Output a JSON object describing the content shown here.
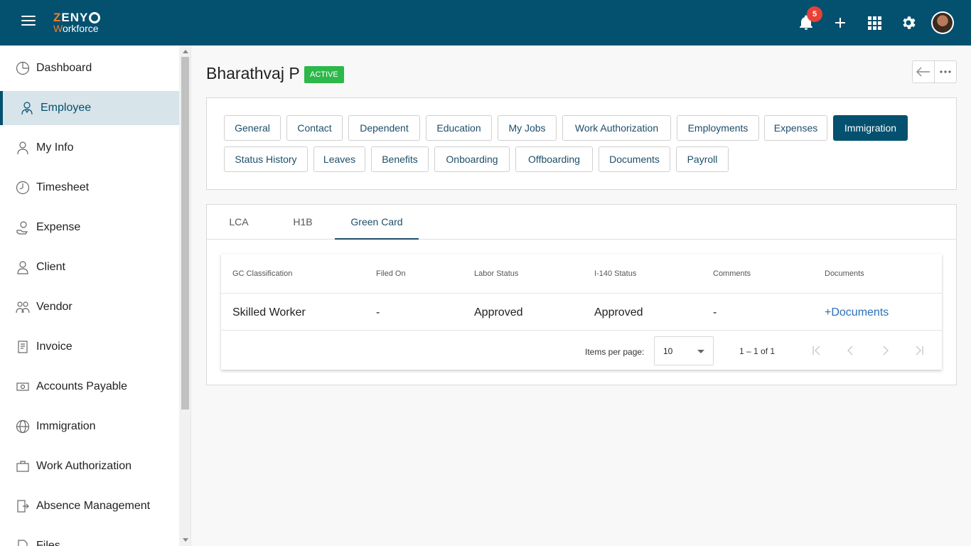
{
  "header": {
    "logo_top_letter": "Z",
    "logo_top_rest": "ENY",
    "logo_sub_first": "W",
    "logo_sub_rest": "orkforce",
    "notification_count": "5"
  },
  "sidebar": {
    "items": [
      {
        "label": "Dashboard",
        "icon": "dashboard-icon"
      },
      {
        "label": "Employee",
        "icon": "employee-icon"
      },
      {
        "label": "My Info",
        "icon": "my-info-icon"
      },
      {
        "label": "Timesheet",
        "icon": "clock-icon"
      },
      {
        "label": "Expense",
        "icon": "expense-icon"
      },
      {
        "label": "Client",
        "icon": "person-icon"
      },
      {
        "label": "Vendor",
        "icon": "vendor-icon"
      },
      {
        "label": "Invoice",
        "icon": "invoice-icon"
      },
      {
        "label": "Accounts Payable",
        "icon": "payable-icon"
      },
      {
        "label": "Immigration",
        "icon": "globe-icon"
      },
      {
        "label": "Work Authorization",
        "icon": "briefcase-icon"
      },
      {
        "label": "Absence Management",
        "icon": "exit-icon"
      },
      {
        "label": "Files",
        "icon": "file-icon"
      }
    ],
    "active_index": 1
  },
  "employee": {
    "name": "Bharathvaj P",
    "status": "ACTIVE"
  },
  "section_tabs": [
    "General",
    "Contact",
    "Dependent",
    "Education",
    "My Jobs",
    "Work Authorization",
    "Employments",
    "Expenses",
    "Immigration",
    "Status History",
    "Leaves",
    "Benefits",
    "Onboarding",
    "Offboarding",
    "Documents",
    "Payroll"
  ],
  "active_section_tab": "Immigration",
  "immigration_tabs": [
    "LCA",
    "H1B",
    "Green Card"
  ],
  "active_immigration_tab": "Green Card",
  "table": {
    "columns": [
      "GC Classification",
      "Filed On",
      "Labor Status",
      "I-140 Status",
      "Comments",
      "Documents"
    ],
    "rows": [
      [
        "Skilled Worker",
        "-",
        "Approved",
        "Approved",
        "-",
        "+Documents"
      ]
    ]
  },
  "pagination": {
    "items_per_page_label": "Items per page:",
    "items_per_page": "10",
    "range": "1 – 1 of 1"
  },
  "colors": {
    "primary": "#03506f",
    "accent_orange": "#f07f2a",
    "status_green": "#2db84b",
    "badge_red": "#e8403a",
    "link_blue": "#2a6fb8"
  }
}
